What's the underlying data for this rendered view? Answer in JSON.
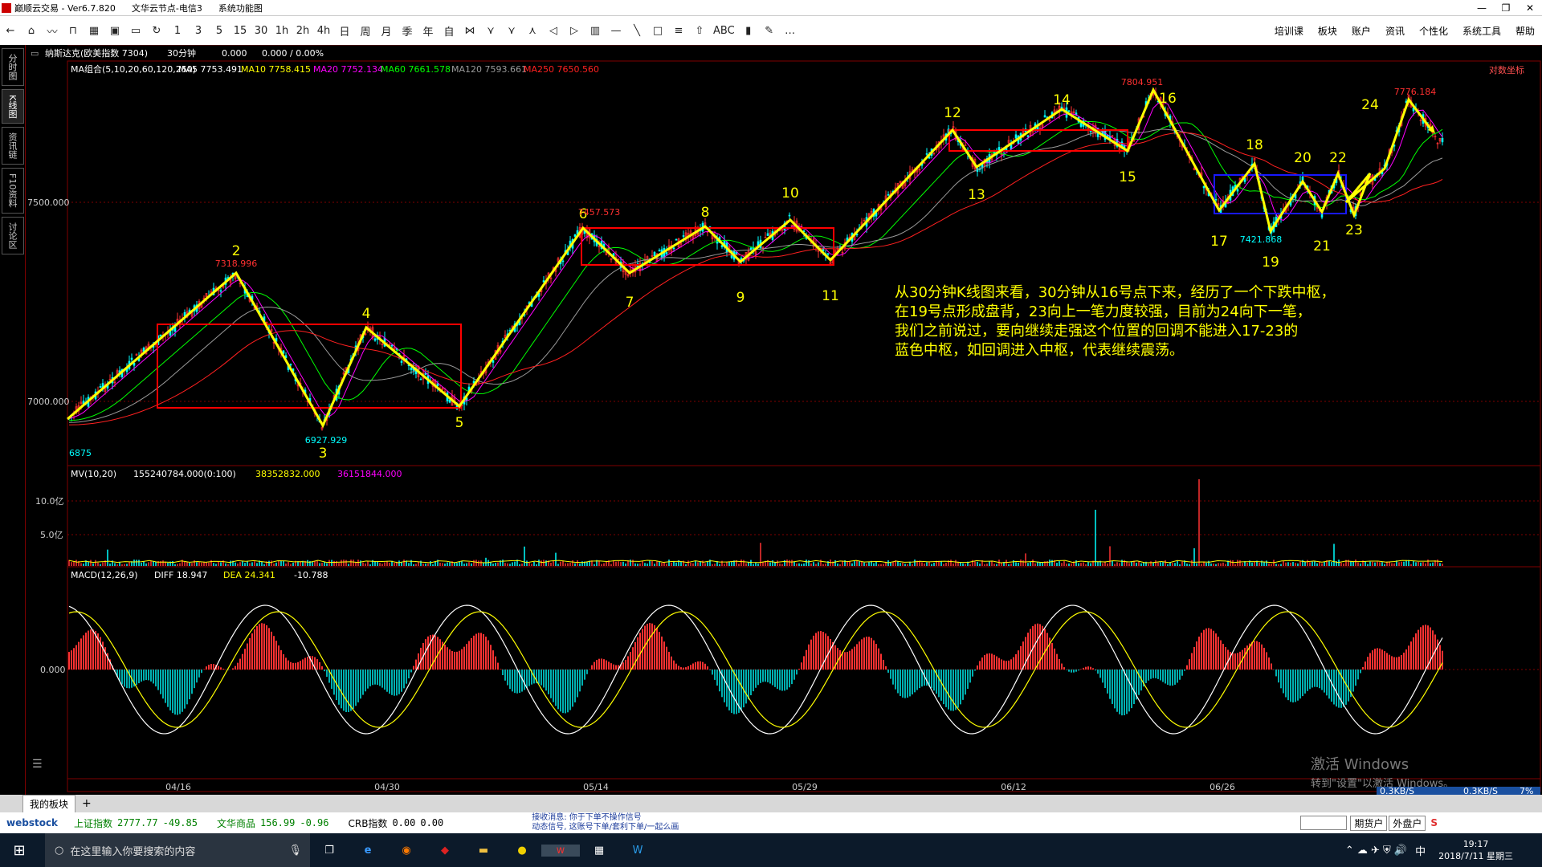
{
  "window": {
    "title": "巅顺云交易 - Ver6.7.820",
    "node": "文华云节点-电信3",
    "menu_label": "系统功能图"
  },
  "toolbar": {
    "items": [
      "←",
      "⌂",
      "〰",
      "⊓",
      "▦",
      "▣",
      "▭",
      "↻",
      "1",
      "3",
      "5",
      "15",
      "30",
      "1h",
      "2h",
      "4h",
      "日",
      "周",
      "月",
      "季",
      "年",
      "自",
      "⋈",
      "⋎",
      "⋎",
      "⋏",
      "◁",
      "▷",
      "▥",
      "—",
      "╲",
      "□",
      "≡",
      "⇧",
      "ABC",
      "▮",
      "✎",
      "…"
    ],
    "right": [
      "培训课",
      "板块",
      "账户",
      "资讯",
      "个性化",
      "系统工具",
      "帮助"
    ]
  },
  "side_tabs": [
    "分时图",
    "K线图",
    "资讯链",
    "F10资料",
    "讨论区"
  ],
  "chart_header": {
    "symbol": "纳斯达克(欧美指数 7304)",
    "period": "30分钟",
    "price": "0.000",
    "change": "0.000 / 0.00%",
    "coord_label": "对数坐标"
  },
  "ma_legend": {
    "group": "MA组合(5,10,20,60,120,250)",
    "items": [
      {
        "label": "MA5 7753.491",
        "color": "#ffffff"
      },
      {
        "label": "MA10 7758.415",
        "color": "#ffff00"
      },
      {
        "label": "MA20 7752.134",
        "color": "#ff00ff"
      },
      {
        "label": "MA60 7661.578",
        "color": "#00ff00"
      },
      {
        "label": "MA120 7593.661",
        "color": "#999999"
      },
      {
        "label": "MA250 7650.560",
        "color": "#ff2020"
      }
    ]
  },
  "price_axis": {
    "ticks": [
      "7500.000",
      "7000.000"
    ]
  },
  "price_labels": [
    {
      "text": "7318.996",
      "color": "#ff3030"
    },
    {
      "text": "6927.929",
      "color": "#00ffff"
    },
    {
      "text": "7457.573",
      "color": "#ff3030"
    },
    {
      "text": "7804.951",
      "color": "#ff3030"
    },
    {
      "text": "7421.868",
      "color": "#00ffff"
    },
    {
      "text": "7776.184",
      "color": "#ff3030"
    },
    {
      "text": "6875",
      "color": "#00ffff"
    }
  ],
  "wave_numbers": [
    "2",
    "3",
    "4",
    "5",
    "6",
    "7",
    "8",
    "9",
    "10",
    "11",
    "12",
    "13",
    "14",
    "15",
    "16",
    "17",
    "18",
    "19",
    "20",
    "21",
    "22",
    "23",
    "24"
  ],
  "annotation": [
    "从30分钟K线图来看，30分钟从16号点下来，经历了一个下跌中枢，",
    "在19号点形成盘背，23向上一笔力度较强，目前为24向下一笔，",
    "我们之前说过，要向继续走强这个位置的回调不能进入17-23的",
    "蓝色中枢，如回调进入中枢，代表继续震荡。"
  ],
  "volume": {
    "legend": "MV(10,20)",
    "v1": "155240784.000(0:100)",
    "v2": "38352832.000",
    "v3": "36151844.000",
    "ticks": [
      "10.0亿",
      "5.0亿"
    ]
  },
  "macd": {
    "legend": "MACD(12,26,9)",
    "diff": "DIFF 18.947",
    "dea": "DEA 24.341",
    "val": "-10.788",
    "zero": "0.000"
  },
  "dates": [
    "04/16",
    "04/30",
    "05/14",
    "05/29",
    "06/12",
    "06/26"
  ],
  "watermark": {
    "line1": "激活 Windows",
    "line2": "转到\"设置\"以激活 Windows。"
  },
  "net_speed": {
    "down": "0.3KB/S",
    "up": "0.3KB/S",
    "pct": "7%"
  },
  "bottom_tab": "我的板块",
  "status": {
    "logo": "webstock",
    "idx1_name": "上证指数",
    "idx1_val": "2777.77",
    "idx1_chg": "-49.85",
    "idx2_name": "文华商品",
    "idx2_val": "156.99",
    "idx2_chg": "-0.96",
    "idx3_name": "CRB指数",
    "idx3_val": "0.00",
    "idx3_chg": "0.00",
    "news1": "接收消息: 你于下单不操作信号",
    "news2": "动态信号, 这账号下单/套利下单/一起么画",
    "btn1": "期货户",
    "btn2": "外盘户"
  },
  "taskbar": {
    "search_placeholder": "在这里输入你要搜索的内容",
    "time": "19:17",
    "date": "2018/7/11 星期三",
    "ime": "中"
  },
  "colors": {
    "up": "#ff3232",
    "down": "#00ffff",
    "frame": "#7f0000",
    "pen": "#ffff00",
    "zs_red": "#ff0000",
    "zs_blue": "#0000ff"
  }
}
